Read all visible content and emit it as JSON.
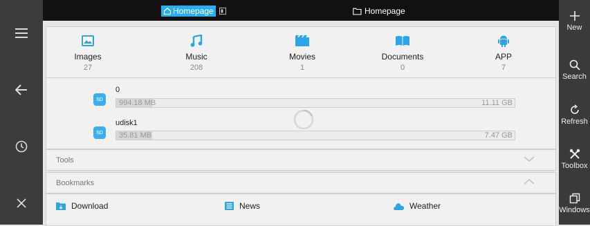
{
  "topbar": {
    "tabs": [
      {
        "label": "Homepage",
        "active": true
      },
      {
        "label": "Homepage",
        "active": false
      }
    ]
  },
  "left_rail": {
    "items": [
      "menu-icon",
      "back-arrow-icon",
      "history-clock-icon",
      "close-icon"
    ]
  },
  "right_rail": {
    "items": [
      {
        "label": "New",
        "icon": "plus-icon"
      },
      {
        "label": "Search",
        "icon": "search-icon"
      },
      {
        "label": "Refresh",
        "icon": "refresh-icon"
      },
      {
        "label": "Toolbox",
        "icon": "toolbox-icon"
      },
      {
        "label": "Windows",
        "icon": "windows-icon"
      }
    ]
  },
  "categories": [
    {
      "name": "Images",
      "count": "27",
      "icon": "image-icon"
    },
    {
      "name": "Music",
      "count": "208",
      "icon": "music-icon"
    },
    {
      "name": "Movies",
      "count": "1",
      "icon": "movie-icon"
    },
    {
      "name": "Documents",
      "count": "0",
      "icon": "book-icon"
    },
    {
      "name": "APP",
      "count": "7",
      "icon": "android-icon"
    }
  ],
  "storage": [
    {
      "badge": "SD",
      "name": "0",
      "used": "994.18 MB",
      "total": "11.11 GB",
      "fraction": 0.09
    },
    {
      "badge": "SD",
      "name": "udisk1",
      "used": "35.81 MB",
      "total": "7.47 GB",
      "fraction": 0.09
    }
  ],
  "sections": {
    "tools": "Tools",
    "bookmarks": "Bookmarks"
  },
  "bookmarks": [
    {
      "label": "Download",
      "icon": "download-folder-icon"
    },
    {
      "label": "News",
      "icon": "news-icon"
    },
    {
      "label": "Weather",
      "icon": "weather-icon"
    }
  ],
  "colors": {
    "accent": "#27aef0",
    "rail": "#3c3c3c"
  }
}
